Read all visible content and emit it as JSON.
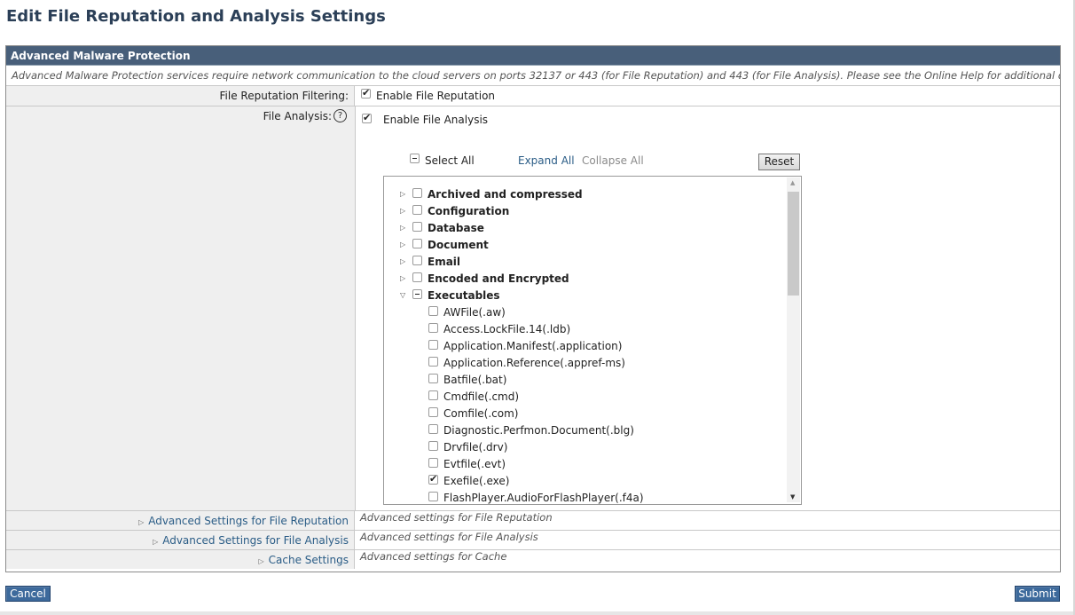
{
  "page_title": "Edit File Reputation and Analysis Settings",
  "panel": {
    "header": "Advanced Malware Protection",
    "description": "Advanced Malware Protection services require network communication to the cloud servers on ports 32137 or 443 (for File Reputation) and 443 (for File Analysis). Please see the Online Help for additional details."
  },
  "file_reputation": {
    "label": "File Reputation Filtering:",
    "option": "Enable File Reputation",
    "checked": true
  },
  "file_analysis": {
    "label": "File Analysis:",
    "help_icon": "?",
    "option": "Enable File Analysis",
    "checked": true,
    "select_all": "Select All",
    "expand_all": "Expand All",
    "collapse_all": "Collapse All",
    "reset": "Reset",
    "categories": [
      {
        "label": "Archived and compressed",
        "expanded": false,
        "state": "unchecked"
      },
      {
        "label": "Configuration",
        "expanded": false,
        "state": "unchecked"
      },
      {
        "label": "Database",
        "expanded": false,
        "state": "unchecked"
      },
      {
        "label": "Document",
        "expanded": false,
        "state": "unchecked"
      },
      {
        "label": "Email",
        "expanded": false,
        "state": "unchecked"
      },
      {
        "label": "Encoded and Encrypted",
        "expanded": false,
        "state": "unchecked"
      },
      {
        "label": "Executables",
        "expanded": true,
        "state": "partial"
      }
    ],
    "executables": [
      {
        "label": "AWFile(.aw)",
        "checked": false
      },
      {
        "label": "Access.LockFile.14(.ldb)",
        "checked": false
      },
      {
        "label": "Application.Manifest(.application)",
        "checked": false
      },
      {
        "label": "Application.Reference(.appref-ms)",
        "checked": false
      },
      {
        "label": "Batfile(.bat)",
        "checked": false
      },
      {
        "label": "Cmdfile(.cmd)",
        "checked": false
      },
      {
        "label": "Comfile(.com)",
        "checked": false
      },
      {
        "label": "Diagnostic.Perfmon.Document(.blg)",
        "checked": false
      },
      {
        "label": "Drvfile(.drv)",
        "checked": false
      },
      {
        "label": "Evtfile(.evt)",
        "checked": false
      },
      {
        "label": "Exefile(.exe)",
        "checked": true
      },
      {
        "label": "FlashPlayer.AudioForFlashPlayer(.f4a)",
        "checked": false
      }
    ]
  },
  "advanced": [
    {
      "label": "Advanced Settings for File Reputation",
      "value": "Advanced settings for File Reputation"
    },
    {
      "label": "Advanced Settings for File Analysis",
      "value": "Advanced settings for File Analysis"
    },
    {
      "label": "Cache Settings",
      "value": "Advanced settings for Cache"
    }
  ],
  "buttons": {
    "cancel": "Cancel",
    "submit": "Submit"
  },
  "colors": {
    "header_bg": "#485f7a",
    "title": "#2b3f57",
    "link": "#2a5c86",
    "button_bg": "#3d6a9c"
  },
  "icons": {
    "expand": "triangle-right-icon",
    "collapse": "triangle-down-icon",
    "help": "help-icon"
  }
}
